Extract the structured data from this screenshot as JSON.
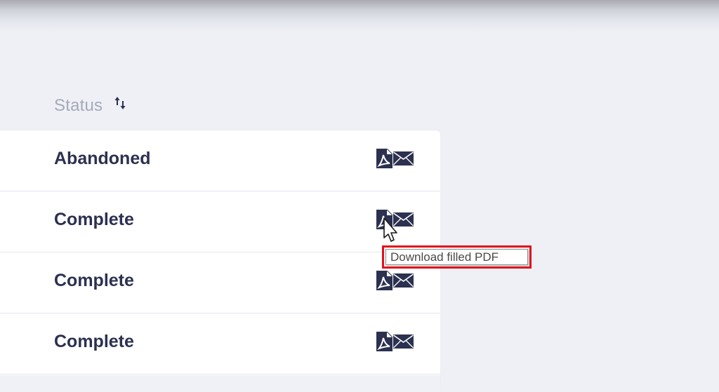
{
  "table": {
    "status_header": "Status",
    "sort_icon": "sort-arrows-icon",
    "rows": [
      {
        "status": "Abandoned",
        "pdf_icon": "pdf-file-icon",
        "mail_icon": "envelope-icon"
      },
      {
        "status": "Complete",
        "pdf_icon": "pdf-file-icon",
        "mail_icon": "envelope-icon"
      },
      {
        "status": "Complete",
        "pdf_icon": "pdf-file-icon",
        "mail_icon": "envelope-icon"
      },
      {
        "status": "Complete",
        "pdf_icon": "pdf-file-icon",
        "mail_icon": "envelope-icon"
      }
    ]
  },
  "tooltip": {
    "text": "Download filled PDF",
    "highlight_color": "#e3101b"
  },
  "colors": {
    "page_background": "#eef0f6",
    "status_text": "#2c3150",
    "header_text": "#a6a9b8",
    "icon_color": "#2c3150"
  }
}
